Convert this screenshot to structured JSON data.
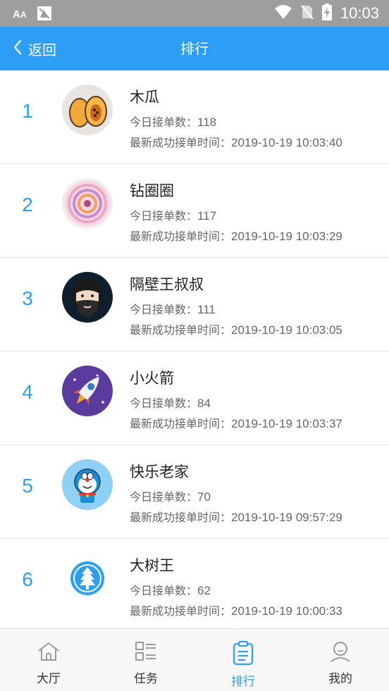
{
  "status_bar": {
    "time": "10:03",
    "colors": {
      "bg": "#9e9e9e"
    },
    "icons": [
      "font-size-icon",
      "screenshot-icon",
      "wifi-icon",
      "no-sim-icon",
      "battery-charging-icon"
    ]
  },
  "header": {
    "back_label": "返回",
    "title": "排行",
    "color": "#2c9ef5"
  },
  "ranking": [
    {
      "rank": "1",
      "name": "木瓜",
      "orders_label": "今日接单数：",
      "orders": "118",
      "time_label": "最新成功接单时间：",
      "time": "2019-10-19 10:03:40",
      "avatar_icon": "papaya-avatar"
    },
    {
      "rank": "2",
      "name": "钻圈圈",
      "orders_label": "今日接单数：",
      "orders": "117",
      "time_label": "最新成功接单时间：",
      "time": "2019-10-19 10:03:29",
      "avatar_icon": "swirl-avatar"
    },
    {
      "rank": "3",
      "name": "隔壁王叔叔",
      "orders_label": "今日接单数：",
      "orders": "111",
      "time_label": "最新成功接单时间：",
      "time": "2019-10-19 10:03:05",
      "avatar_icon": "bearded-man-avatar"
    },
    {
      "rank": "4",
      "name": "小火箭",
      "orders_label": "今日接单数：",
      "orders": "84",
      "time_label": "最新成功接单时间：",
      "time": "2019-10-19 10:03:37",
      "avatar_icon": "rocket-avatar"
    },
    {
      "rank": "5",
      "name": "快乐老家",
      "orders_label": "今日接单数：",
      "orders": "70",
      "time_label": "最新成功接单时间：",
      "time": "2019-10-19 09:57:29",
      "avatar_icon": "doraemon-avatar"
    },
    {
      "rank": "6",
      "name": "大树王",
      "orders_label": "今日接单数：",
      "orders": "62",
      "time_label": "最新成功接单时间：",
      "time": "2019-10-19 10:00:33",
      "avatar_icon": "tree-avatar"
    }
  ],
  "bottom_nav": {
    "items": [
      {
        "label": "大厅",
        "icon": "home-icon",
        "active": false
      },
      {
        "label": "任务",
        "icon": "task-list-icon",
        "active": false
      },
      {
        "label": "排行",
        "icon": "clipboard-icon",
        "active": true
      },
      {
        "label": "我的",
        "icon": "person-icon",
        "active": false
      }
    ],
    "active_color": "#2c9ef5"
  }
}
